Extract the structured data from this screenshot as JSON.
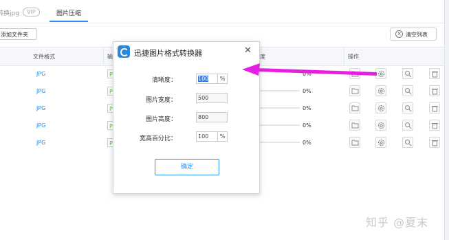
{
  "tabs": [
    {
      "label": "转换jpg"
    },
    {
      "label": "图片压缩"
    }
  ],
  "vip_badge": "VIP",
  "toolbar": {
    "add_folder": "添加文件夹",
    "clear_list": "清空列表"
  },
  "table": {
    "headers": {
      "format": "文件格式",
      "output": "输",
      "progress": "度",
      "actions": "操作"
    },
    "rows": [
      {
        "format": "JPG",
        "out": "P",
        "pct": "0%"
      },
      {
        "format": "JPG",
        "out": "P",
        "pct": "0%"
      },
      {
        "format": "JPG",
        "out": "P",
        "pct": "0%"
      },
      {
        "format": "JPG",
        "out": "P",
        "pct": "0%"
      },
      {
        "format": "JPG",
        "out": "P",
        "pct": "0%"
      }
    ]
  },
  "dialog": {
    "title": "迅捷图片格式转换器",
    "fields": {
      "clarity": {
        "label": "清晰度：",
        "value": "100",
        "unit": "%"
      },
      "width": {
        "label": "图片宽度：",
        "value": "500"
      },
      "height": {
        "label": "图片高度：",
        "value": "800"
      },
      "ratio": {
        "label": "宽高百分比：",
        "value": "100",
        "unit": "%"
      }
    },
    "ok": "确定"
  },
  "watermark": "知乎 @夏末",
  "colors": {
    "accent": "#2d8cf0",
    "arrow": "#e620e0"
  }
}
